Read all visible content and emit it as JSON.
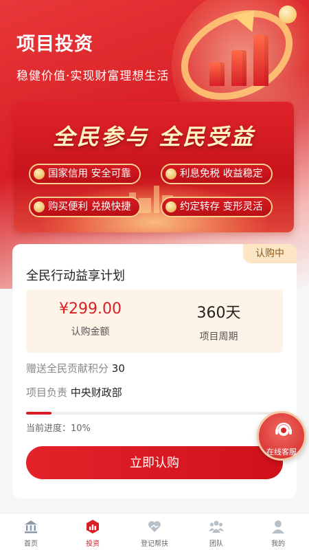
{
  "header": {
    "title": "项目投资",
    "subtitle": "稳健价值·实现财富理想生活"
  },
  "banner": {
    "headline": "全民参与 全民受益",
    "features": [
      "国家信用 安全可靠",
      "利息免税 收益稳定",
      "购买便利 兑换快捷",
      "约定转存 变形灵活"
    ]
  },
  "product": {
    "status": "认购中",
    "name": "全民行动益享计划",
    "amount": "¥299.00",
    "amount_label": "认购金额",
    "period": "360天",
    "period_label": "项目周期",
    "bonus_label": "赠送全民贡献积分",
    "bonus_value": "30",
    "owner_label": "项目负责",
    "owner_value": "中央财政部",
    "progress_text": "当前进度：10%",
    "progress": 0.1,
    "buy_label": "立即认购"
  },
  "service": {
    "label": "在线客服"
  },
  "tabbar": {
    "tabs": [
      {
        "label": "首页",
        "icon": "bank-icon"
      },
      {
        "label": "投资",
        "icon": "invest-icon",
        "active": true
      },
      {
        "label": "登记帮扶",
        "icon": "handshake-icon"
      },
      {
        "label": "团队",
        "icon": "team-icon"
      },
      {
        "label": "我的",
        "icon": "user-icon"
      }
    ]
  },
  "colors": {
    "accent": "#d81e26",
    "badge_bg": "#fde6c4",
    "stats_bg": "#fdf3e6"
  }
}
